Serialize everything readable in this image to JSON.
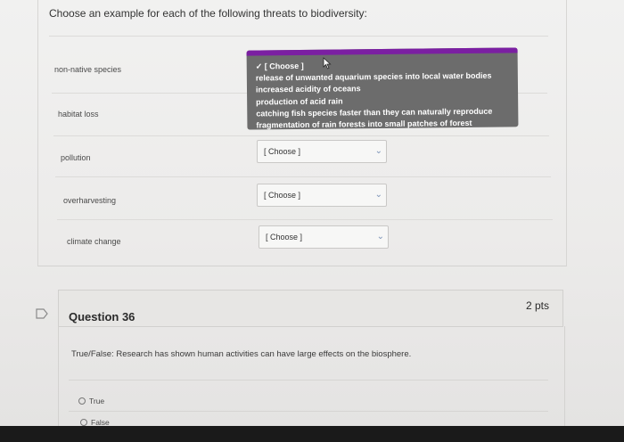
{
  "prompt": "Choose an example for each of the following threats to biodiversity:",
  "threats": [
    {
      "label": "non-native species"
    },
    {
      "label": "habitat loss"
    },
    {
      "label": "pollution",
      "selected": "[ Choose ]"
    },
    {
      "label": "overharvesting",
      "selected": "[ Choose ]"
    },
    {
      "label": "climate change",
      "selected": "[ Choose ]"
    }
  ],
  "dropdown": {
    "options": [
      "✓ [ Choose ]",
      "release of unwanted aquarium species into local water bodies",
      "increased acidity of oceans",
      "production of acid rain",
      "catching fish species faster than they can naturally reproduce",
      "fragmentation of rain forests into small patches of forest"
    ]
  },
  "icons": {
    "chevron": "chevron-down-icon",
    "cursor": "mouse-pointer-icon",
    "flag": "flag-icon"
  },
  "question": {
    "title": "Question 36",
    "points": "2 pts",
    "text": "True/False: Research has shown human activities can have large effects on the biosphere.",
    "options": [
      "True",
      "False"
    ]
  },
  "colors": {
    "dropdown_bg": "#6c6c6c",
    "dropdown_accent": "#7b1fa2",
    "chevron": "#7c93b8"
  }
}
